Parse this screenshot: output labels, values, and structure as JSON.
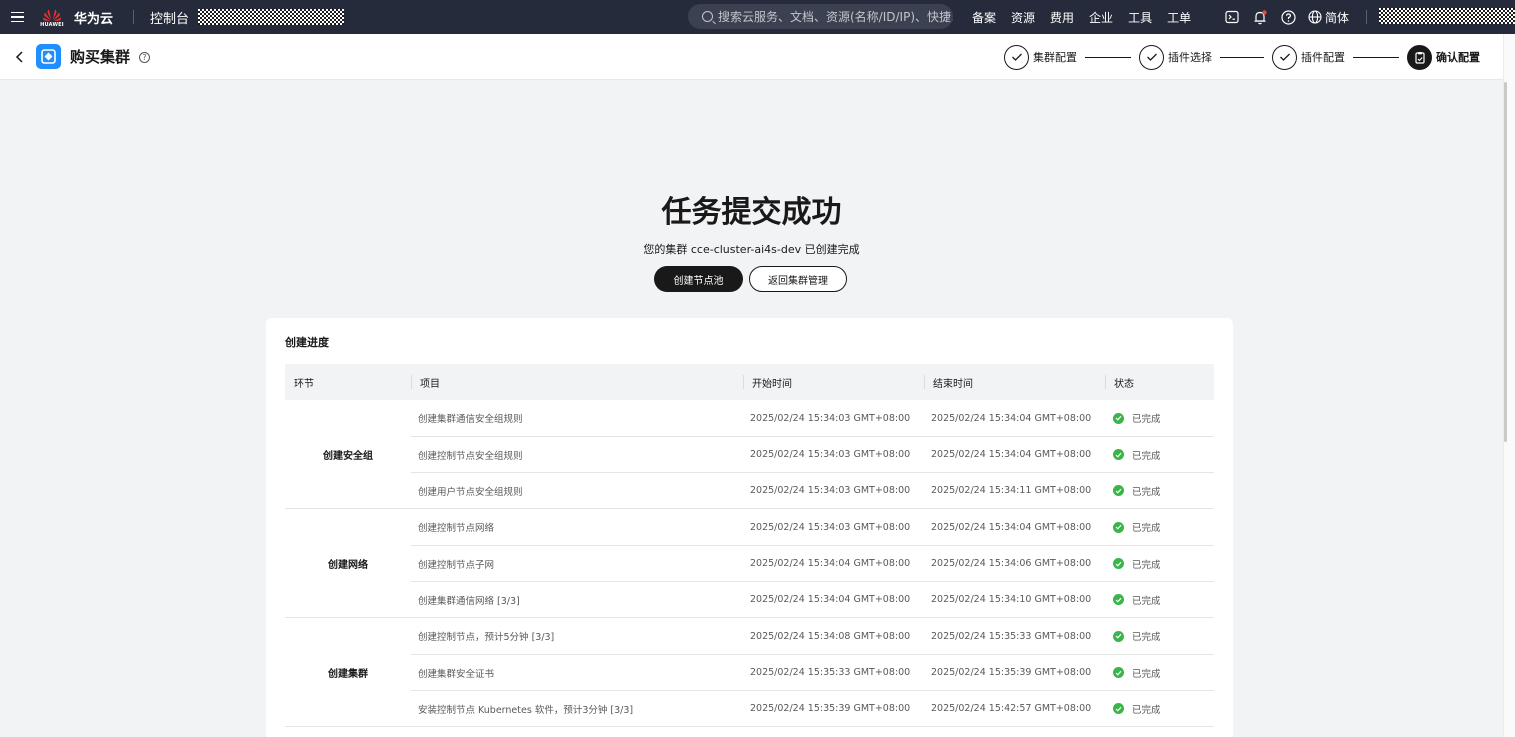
{
  "topnav": {
    "brand_logo_text": "HUAWEI",
    "brand": "华为云",
    "console": "控制台",
    "search_placeholder": "搜索云服务、文档、资源(名称/ID/IP)、快捷...",
    "links": [
      "备案",
      "资源",
      "费用",
      "企业",
      "工具",
      "工单"
    ],
    "lang": "简体",
    "icons": [
      "terminal-icon",
      "bell-icon",
      "help-icon",
      "globe-icon"
    ],
    "notification_dot_color": "#e84a3c"
  },
  "header": {
    "title": "购买集群",
    "steps": [
      {
        "label": "集群配置",
        "state": "done"
      },
      {
        "label": "插件选择",
        "state": "done"
      },
      {
        "label": "插件配置",
        "state": "done"
      },
      {
        "label": "确认配置",
        "state": "active"
      }
    ]
  },
  "result": {
    "title": "任务提交成功",
    "subtitle": "您的集群 cce-cluster-ai4s-dev 已创建完成",
    "primary_button": "创建节点池",
    "secondary_button": "返回集群管理"
  },
  "progress": {
    "title": "创建进度",
    "columns": {
      "stage": "环节",
      "item": "项目",
      "start": "开始时间",
      "end": "结束时间",
      "status": "状态"
    },
    "status_color": "#39b54a",
    "groups": [
      {
        "stage": "创建安全组",
        "rows": [
          {
            "item": "创建集群通信安全组规则",
            "start": "2025/02/24 15:34:03 GMT+08:00",
            "end": "2025/02/24 15:34:04 GMT+08:00",
            "status": "已完成"
          },
          {
            "item": "创建控制节点安全组规则",
            "start": "2025/02/24 15:34:03 GMT+08:00",
            "end": "2025/02/24 15:34:04 GMT+08:00",
            "status": "已完成"
          },
          {
            "item": "创建用户节点安全组规则",
            "start": "2025/02/24 15:34:03 GMT+08:00",
            "end": "2025/02/24 15:34:11 GMT+08:00",
            "status": "已完成"
          }
        ]
      },
      {
        "stage": "创建网络",
        "rows": [
          {
            "item": "创建控制节点网络",
            "start": "2025/02/24 15:34:03 GMT+08:00",
            "end": "2025/02/24 15:34:04 GMT+08:00",
            "status": "已完成"
          },
          {
            "item": "创建控制节点子网",
            "start": "2025/02/24 15:34:04 GMT+08:00",
            "end": "2025/02/24 15:34:06 GMT+08:00",
            "status": "已完成"
          },
          {
            "item": "创建集群通信网络 [3/3]",
            "start": "2025/02/24 15:34:04 GMT+08:00",
            "end": "2025/02/24 15:34:10 GMT+08:00",
            "status": "已完成"
          }
        ]
      },
      {
        "stage": "创建集群",
        "rows": [
          {
            "item": "创建控制节点，预计5分钟 [3/3]",
            "start": "2025/02/24 15:34:08 GMT+08:00",
            "end": "2025/02/24 15:35:33 GMT+08:00",
            "status": "已完成"
          },
          {
            "item": "创建集群安全证书",
            "start": "2025/02/24 15:35:33 GMT+08:00",
            "end": "2025/02/24 15:35:39 GMT+08:00",
            "status": "已完成"
          },
          {
            "item": "安装控制节点 Kubernetes 软件，预计3分钟 [3/3]",
            "start": "2025/02/24 15:35:39 GMT+08:00",
            "end": "2025/02/24 15:42:57 GMT+08:00",
            "status": "已完成"
          }
        ]
      }
    ]
  }
}
